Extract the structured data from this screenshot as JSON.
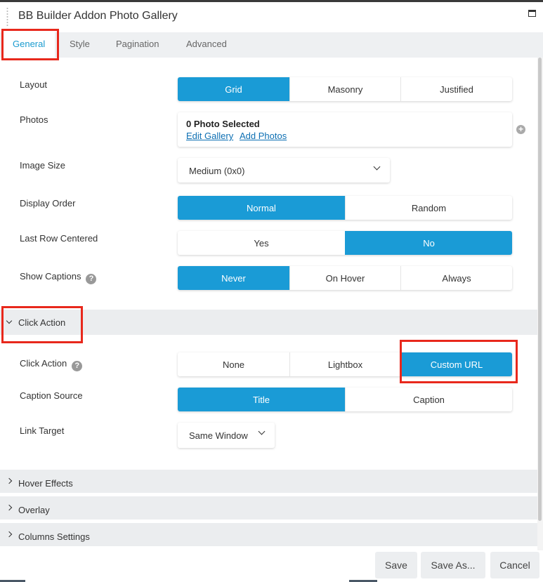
{
  "window": {
    "title": "BB Builder Addon Photo Gallery"
  },
  "tabs": [
    {
      "label": "General",
      "active": true
    },
    {
      "label": "Style"
    },
    {
      "label": "Pagination"
    },
    {
      "label": "Advanced"
    }
  ],
  "fields": {
    "layout": {
      "label": "Layout",
      "options": [
        "Grid",
        "Masonry",
        "Justified"
      ],
      "selected": "Grid"
    },
    "photos": {
      "label": "Photos",
      "count_text": "0 Photo Selected",
      "edit_link": "Edit Gallery",
      "add_link": "Add Photos"
    },
    "image_size": {
      "label": "Image Size",
      "value": "Medium (0x0)"
    },
    "display_order": {
      "label": "Display Order",
      "options": [
        "Normal",
        "Random"
      ],
      "selected": "Normal"
    },
    "last_row_centered": {
      "label": "Last Row Centered",
      "options": [
        "Yes",
        "No"
      ],
      "selected": "No"
    },
    "show_captions": {
      "label": "Show Captions",
      "help": "?",
      "options": [
        "Never",
        "On Hover",
        "Always"
      ],
      "selected": "Never"
    }
  },
  "click_action_section": {
    "title": "Click Action",
    "expanded": true,
    "fields": {
      "click_action": {
        "label": "Click Action",
        "help": "?",
        "options": [
          "None",
          "Lightbox",
          "Custom URL"
        ],
        "selected": "Custom URL"
      },
      "caption_source": {
        "label": "Caption Source",
        "options": [
          "Title",
          "Caption"
        ],
        "selected": "Title"
      },
      "link_target": {
        "label": "Link Target",
        "value": "Same Window"
      }
    }
  },
  "collapsed_sections": [
    "Hover Effects",
    "Overlay",
    "Columns Settings"
  ],
  "footer": {
    "save": "Save",
    "save_as": "Save As...",
    "cancel": "Cancel"
  },
  "colors": {
    "accent": "#1a9bd6",
    "highlight_box": "#e8281c",
    "link": "#0d6fb3"
  },
  "icons": [
    "drag-handle-icon",
    "maximize-icon",
    "help-icon",
    "add-icon",
    "chevron-down-icon",
    "chevron-right-icon"
  ]
}
